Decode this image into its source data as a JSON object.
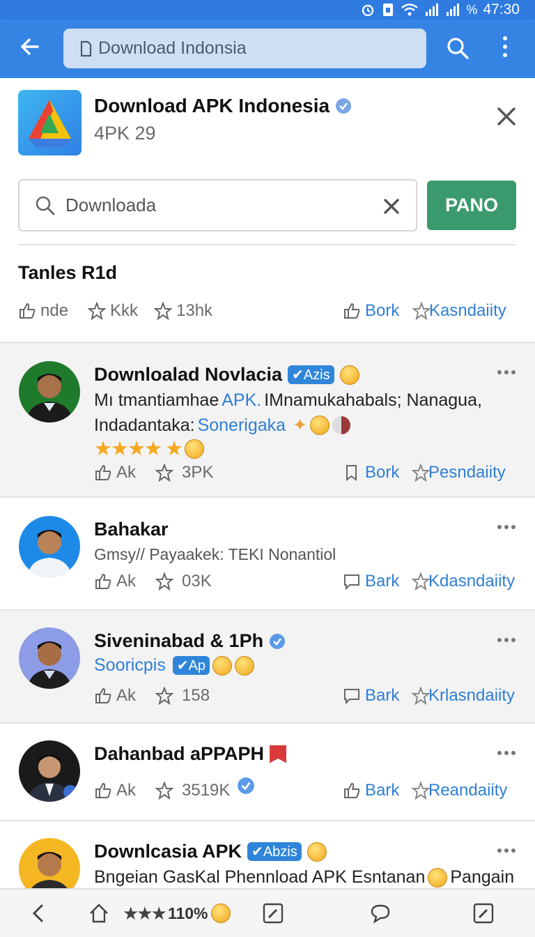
{
  "status_bar": {
    "time": "47:30",
    "battery": "%"
  },
  "browser": {
    "url": "Download Indonsia"
  },
  "app": {
    "title": "Download APK Indonesia",
    "subtitle": "4PK 29"
  },
  "search": {
    "value": "Downloada",
    "button_label": "PANO"
  },
  "section": {
    "title": "Tanles R1d",
    "stats": [
      {
        "icon": "thumbs-up-icon",
        "label": "nde"
      },
      {
        "icon": "star-icon",
        "label": "Kkk"
      },
      {
        "icon": "star-icon",
        "label": "13hk"
      },
      {
        "icon": "thumbs-up-icon",
        "label": "Bork"
      },
      {
        "icon": "star-icon",
        "label": "Kasndaiity"
      }
    ]
  },
  "posts": [
    {
      "name": "Downloalad Novlacia",
      "tag": "✔Azis",
      "text_lines": [
        {
          "plain": "Mı tmantiamhae ",
          "link": "APK.",
          "after": " IMnamukahabals; Nanagua,"
        },
        {
          "plain": "Indadantaka: ",
          "link": "Sonerigaka",
          "after": ""
        }
      ],
      "rating": "★★★★ ★",
      "likes": "Ak",
      "shares": "3PK",
      "action": "Bork",
      "action2": "Pesndaiity"
    },
    {
      "name": "Bahakar",
      "subtitle": "Gmsy// Payaakek: TEKI Nonantiol",
      "likes": "Ak",
      "shares": "03K",
      "action": "Bark",
      "action2": "Kdasndaiity"
    },
    {
      "name": "Siveninabad & 1Ph",
      "link_line": "Sooricpis",
      "tag": "✔Ap",
      "likes": "Ak",
      "shares": "158",
      "action": "Bark",
      "action2": "Krlasndaiity"
    },
    {
      "name": "Dahanbad aPPAPH",
      "likes": "Ak",
      "shares": "3519K",
      "action": "Bark",
      "action2": "Reandaiity"
    },
    {
      "name": "Downlcasia APK",
      "tag": "✔Abzis",
      "subtitle": "Bngeian GasKal  Phennload APK Esntanan",
      "after_emoji": "Pangain"
    }
  ],
  "bottom_bar": {
    "zoom": "110%",
    "rating": "★★★"
  },
  "colors": {
    "appbar": "#3584e4",
    "primary_button": "#3a9a6e",
    "link": "#2e7fd6",
    "star": "#f3a81d"
  }
}
